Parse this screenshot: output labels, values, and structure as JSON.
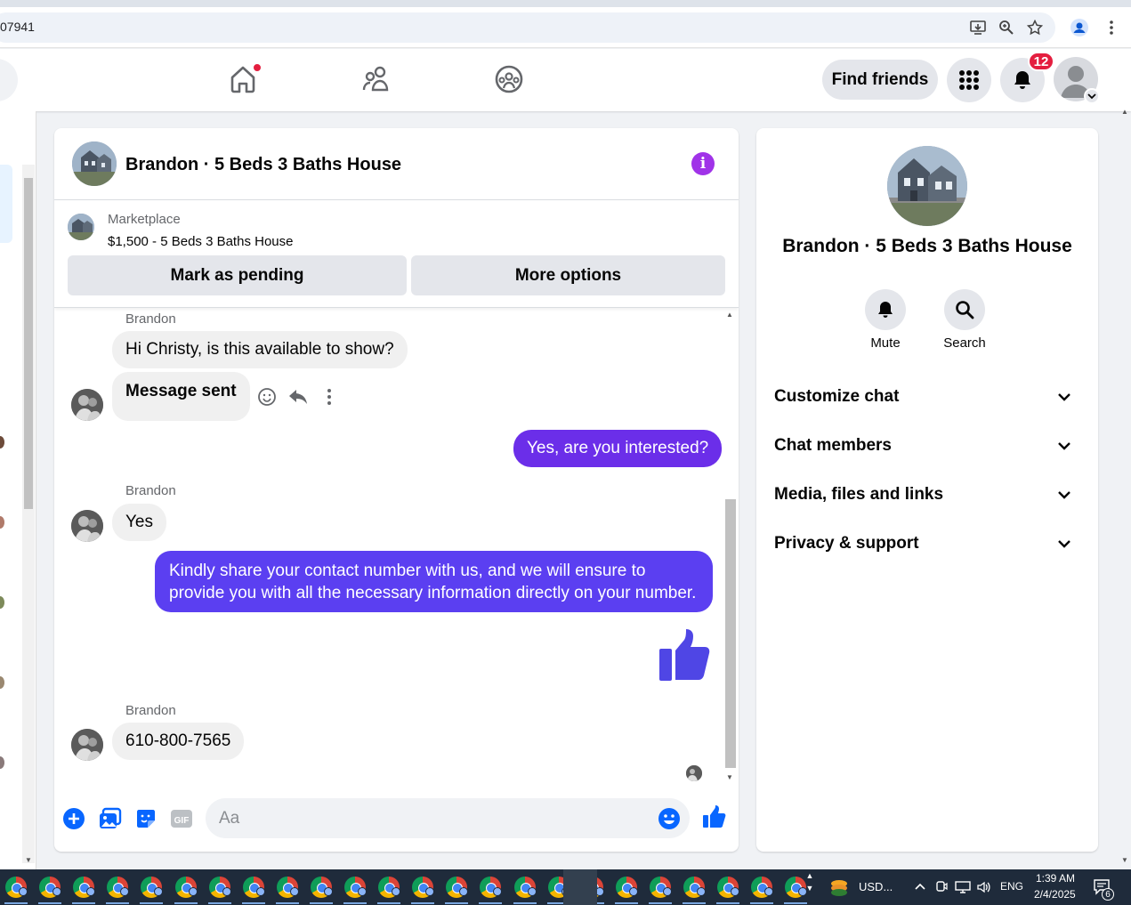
{
  "browser": {
    "url_fragment": "07941"
  },
  "header": {
    "find_friends_label": "Find friends",
    "notification_count": "12"
  },
  "chat": {
    "title": "Brandon · 5 Beds 3 Baths House",
    "marketplace_label": "Marketplace",
    "listing": "$1,500 - 5 Beds 3 Baths House",
    "mark_pending_label": "Mark as pending",
    "more_options_label": "More options",
    "messages": [
      {
        "sender": "Brandon",
        "text": "Hi Christy, is this available to show?"
      },
      {
        "text": "Message sent"
      },
      {
        "text": "Yes, are you interested?"
      },
      {
        "sender": "Brandon",
        "text": "Yes"
      },
      {
        "text": "Kindly share your contact number with us, and we will ensure to provide you with all the necessary information directly on your number."
      },
      {
        "sender": "Brandon",
        "text": "610-800-7565"
      }
    ],
    "composer_placeholder": "Aa"
  },
  "details": {
    "name": "Brandon · 5 Beds 3 Baths House",
    "mute_label": "Mute",
    "search_label": "Search",
    "sections": [
      "Customize chat",
      "Chat members",
      "Media, files and links",
      "Privacy & support"
    ]
  },
  "taskbar": {
    "currency_label": "USD...",
    "language": "ENG",
    "time": "1:39 AM",
    "date": "2/4/2025",
    "notification_count": "6"
  },
  "colors": {
    "accent_purple": "#6b2ee9",
    "accent_blue": "#0866ff",
    "badge_red": "#e41e3f"
  }
}
